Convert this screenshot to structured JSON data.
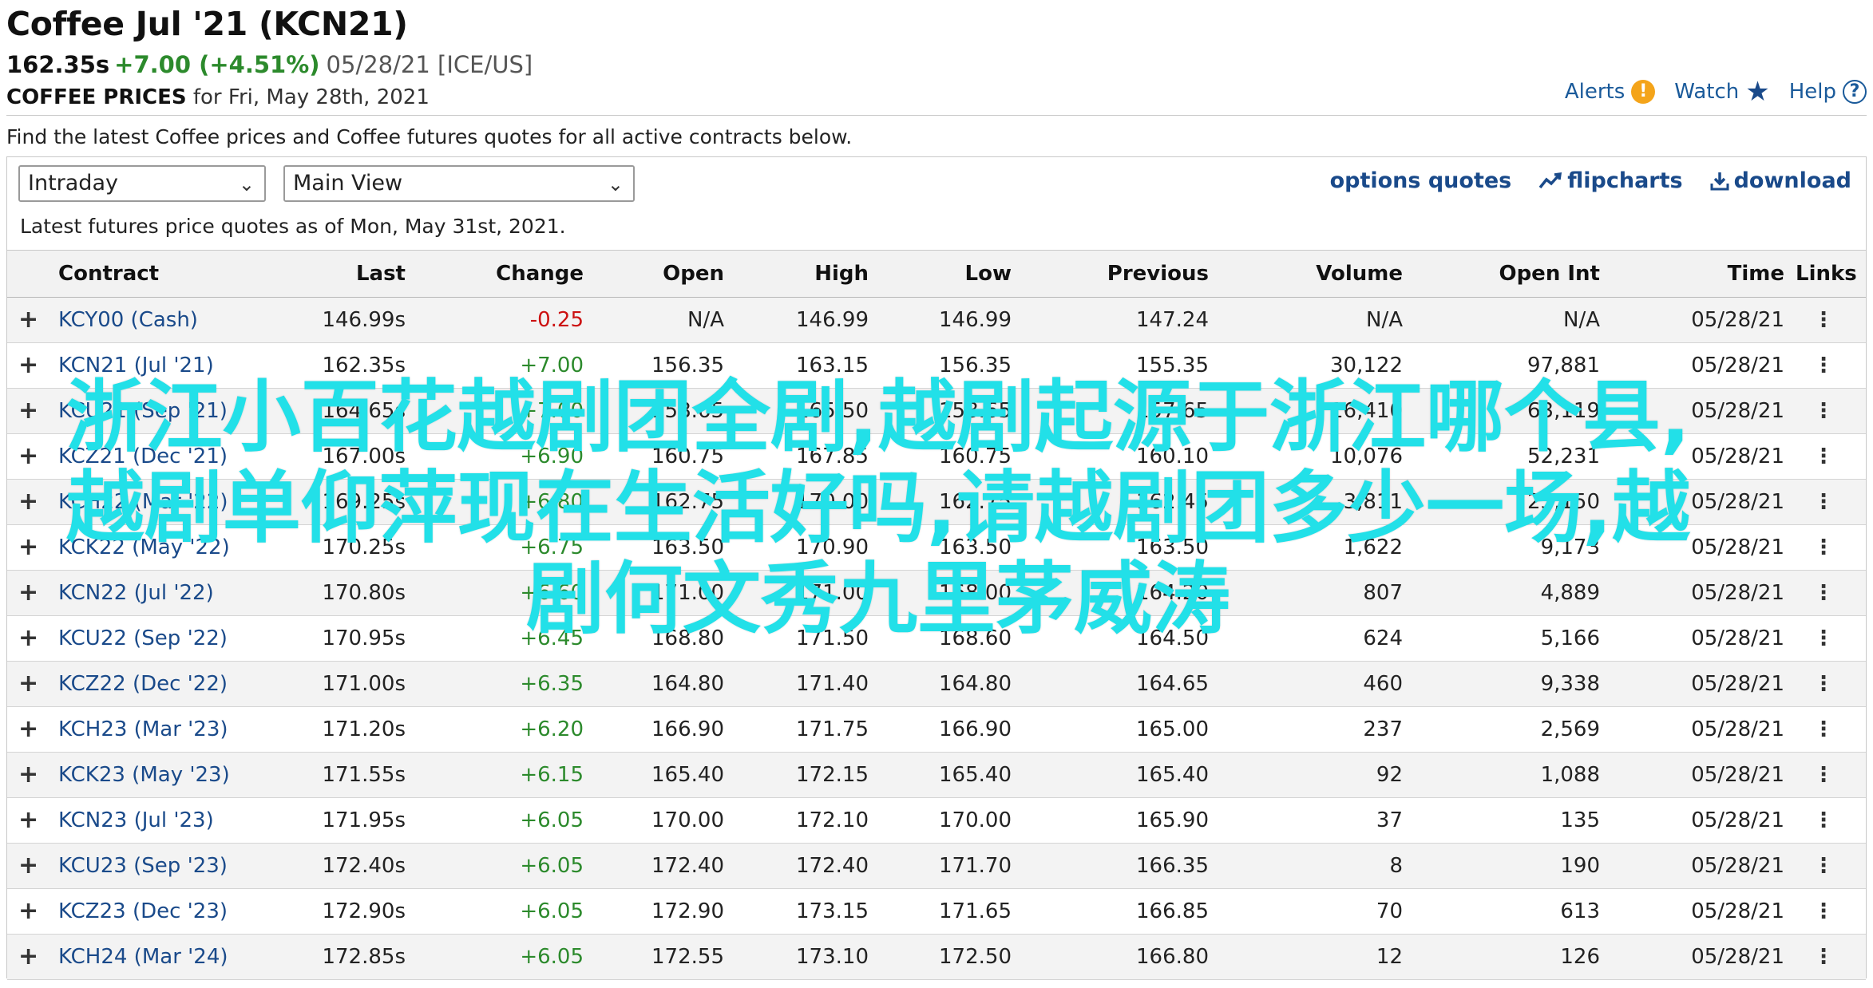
{
  "header": {
    "title": "Coffee Jul '21 (KCN21)",
    "price": "162.35s",
    "change": "+7.00 (+4.51%)",
    "meta": "05/28/21 [ICE/US]",
    "sub_label": "COFFEE PRICES",
    "sub_text": "for Fri, May 28th, 2021"
  },
  "top_links": {
    "alerts": "Alerts",
    "watch": "Watch",
    "help": "Help",
    "alerts_icon": "alert-icon",
    "watch_icon": "star-icon",
    "help_icon": "help-icon"
  },
  "intro": "Find the latest Coffee prices and Coffee futures quotes for all active contracts below.",
  "controls": {
    "period_select": "Intraday",
    "view_select": "Main View",
    "options_quotes": "options quotes",
    "flipcharts": "flipcharts",
    "download": "download"
  },
  "asof": "Latest futures price quotes as of Mon, May 31st, 2021.",
  "table": {
    "headers": [
      "Contract",
      "Last",
      "Change",
      "Open",
      "High",
      "Low",
      "Previous",
      "Volume",
      "Open Int",
      "Time",
      "Links"
    ],
    "rows": [
      {
        "contract": "KCY00 (Cash)",
        "last": "146.99s",
        "change": "-0.25",
        "open": "N/A",
        "high": "146.99",
        "low": "146.99",
        "prev": "147.24",
        "vol": "N/A",
        "oi": "N/A",
        "time": "05/28/21"
      },
      {
        "contract": "KCN21 (Jul '21)",
        "last": "162.35s",
        "change": "+7.00",
        "open": "156.35",
        "high": "163.15",
        "low": "156.35",
        "prev": "155.35",
        "vol": "30,122",
        "oi": "97,881",
        "time": "05/28/21"
      },
      {
        "contract": "KCU21 (Sep '21)",
        "last": "164.65s",
        "change": "+7.00",
        "open": "158.65",
        "high": "165.50",
        "low": "158.65",
        "prev": "157.65",
        "vol": "16,410",
        "oi": "63,119",
        "time": "05/28/21"
      },
      {
        "contract": "KCZ21 (Dec '21)",
        "last": "167.00s",
        "change": "+6.90",
        "open": "160.75",
        "high": "167.85",
        "low": "160.75",
        "prev": "160.10",
        "vol": "10,076",
        "oi": "52,231",
        "time": "05/28/21"
      },
      {
        "contract": "KCH22 (Mar '22)",
        "last": "169.25s",
        "change": "+6.80",
        "open": "162.75",
        "high": "170.00",
        "low": "162.75",
        "prev": "162.45",
        "vol": "3,811",
        "oi": "23,150",
        "time": "05/28/21"
      },
      {
        "contract": "KCK22 (May '22)",
        "last": "170.25s",
        "change": "+6.75",
        "open": "163.50",
        "high": "170.90",
        "low": "163.50",
        "prev": "163.50",
        "vol": "1,622",
        "oi": "9,173",
        "time": "05/28/21"
      },
      {
        "contract": "KCN22 (Jul '22)",
        "last": "170.80s",
        "change": "+6.60",
        "open": "171.00",
        "high": "171.00",
        "low": "168.00",
        "prev": "164.20",
        "vol": "807",
        "oi": "4,889",
        "time": "05/28/21"
      },
      {
        "contract": "KCU22 (Sep '22)",
        "last": "170.95s",
        "change": "+6.45",
        "open": "168.80",
        "high": "171.50",
        "low": "168.60",
        "prev": "164.50",
        "vol": "624",
        "oi": "5,166",
        "time": "05/28/21"
      },
      {
        "contract": "KCZ22 (Dec '22)",
        "last": "171.00s",
        "change": "+6.35",
        "open": "164.80",
        "high": "171.40",
        "low": "164.80",
        "prev": "164.65",
        "vol": "460",
        "oi": "9,338",
        "time": "05/28/21"
      },
      {
        "contract": "KCH23 (Mar '23)",
        "last": "171.20s",
        "change": "+6.20",
        "open": "166.90",
        "high": "171.75",
        "low": "166.90",
        "prev": "165.00",
        "vol": "237",
        "oi": "2,569",
        "time": "05/28/21"
      },
      {
        "contract": "KCK23 (May '23)",
        "last": "171.55s",
        "change": "+6.15",
        "open": "165.40",
        "high": "172.15",
        "low": "165.40",
        "prev": "165.40",
        "vol": "92",
        "oi": "1,088",
        "time": "05/28/21"
      },
      {
        "contract": "KCN23 (Jul '23)",
        "last": "171.95s",
        "change": "+6.05",
        "open": "170.00",
        "high": "172.10",
        "low": "170.00",
        "prev": "165.90",
        "vol": "37",
        "oi": "135",
        "time": "05/28/21"
      },
      {
        "contract": "KCU23 (Sep '23)",
        "last": "172.40s",
        "change": "+6.05",
        "open": "172.40",
        "high": "172.40",
        "low": "171.70",
        "prev": "166.35",
        "vol": "8",
        "oi": "190",
        "time": "05/28/21"
      },
      {
        "contract": "KCZ23 (Dec '23)",
        "last": "172.90s",
        "change": "+6.05",
        "open": "172.90",
        "high": "173.15",
        "low": "171.65",
        "prev": "166.85",
        "vol": "70",
        "oi": "613",
        "time": "05/28/21"
      },
      {
        "contract": "KCH24 (Mar '24)",
        "last": "172.85s",
        "change": "+6.05",
        "open": "172.55",
        "high": "173.10",
        "low": "172.50",
        "prev": "166.80",
        "vol": "12",
        "oi": "126",
        "time": "05/28/21"
      }
    ]
  },
  "overlay": {
    "line1": "浙江小百花越剧团全剧,越剧起源于浙江哪个县,",
    "line2": "越剧单仰萍现在生活好吗,请越剧团多少一场,越",
    "line3": "剧何文秀九里茅威涛"
  },
  "colors": {
    "positive": "#2c8a2c",
    "negative": "#cc1111",
    "link": "#1a4a8a",
    "overlay": "#22e0e8"
  }
}
